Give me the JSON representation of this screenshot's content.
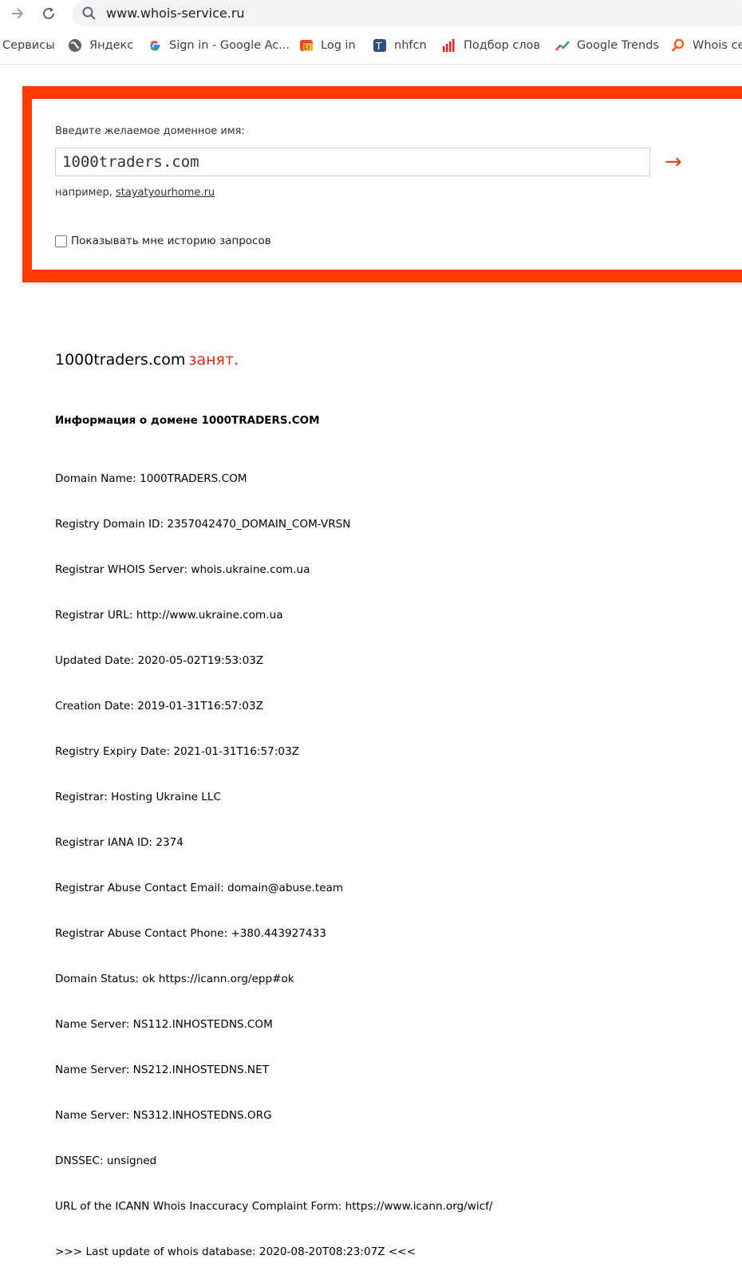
{
  "browser": {
    "url": "www.whois-service.ru",
    "bookmarks": [
      {
        "label": "Сервисы",
        "icon": "apps-icon"
      },
      {
        "label": "Яндекс",
        "icon": "globe-icon"
      },
      {
        "label": "Sign in - Google Ac...",
        "icon": "google-icon"
      },
      {
        "label": "Log in",
        "icon": "login-site-icon"
      },
      {
        "label": "nhfcn",
        "icon": "nhfcn-site-icon"
      },
      {
        "label": "Подбор слов",
        "icon": "bar-chart-icon"
      },
      {
        "label": "Google Trends",
        "icon": "trends-icon"
      },
      {
        "label": "Whois ce",
        "icon": "whois-search-icon"
      }
    ]
  },
  "search": {
    "prompt": "Введите желаемое доменное имя:",
    "value": "1000traders.com",
    "example_prefix": "например,",
    "example_link": "stayatyourhome.ru",
    "history_label": "Показывать мне историю запросов",
    "history_checked": false,
    "arrow": "→"
  },
  "result": {
    "domain": "1000traders.com",
    "status": "занят."
  },
  "info": {
    "title": "Информация о домене 1000TRADERS.COM",
    "lines": [
      "Domain Name: 1000TRADERS.COM",
      "Registry Domain ID: 2357042470_DOMAIN_COM-VRSN",
      "Registrar WHOIS Server: whois.ukraine.com.ua",
      "Registrar URL: http://www.ukraine.com.ua",
      "Updated Date: 2020-05-02T19:53:03Z",
      "Creation Date: 2019-01-31T16:57:03Z",
      "Registry Expiry Date: 2021-01-31T16:57:03Z",
      "Registrar: Hosting Ukraine LLC",
      "Registrar IANA ID: 2374",
      "Registrar Abuse Contact Email: domain@abuse.team",
      "Registrar Abuse Contact Phone: +380.443927433",
      "Domain Status: ok https://icann.org/epp#ok",
      "Name Server: NS112.INHOSTEDNS.COM",
      "Name Server: NS212.INHOSTEDNS.NET",
      "Name Server: NS312.INHOSTEDNS.ORG",
      "DNSSEC: unsigned",
      "URL of the ICANN Whois Inaccuracy Complaint Form: https://www.icann.org/wicf/",
      ">>> Last update of whois database: 2020-08-20T08:23:07Z <<<"
    ]
  },
  "colors": {
    "accent": "#ff3d00",
    "status_taken": "#e0261b"
  }
}
